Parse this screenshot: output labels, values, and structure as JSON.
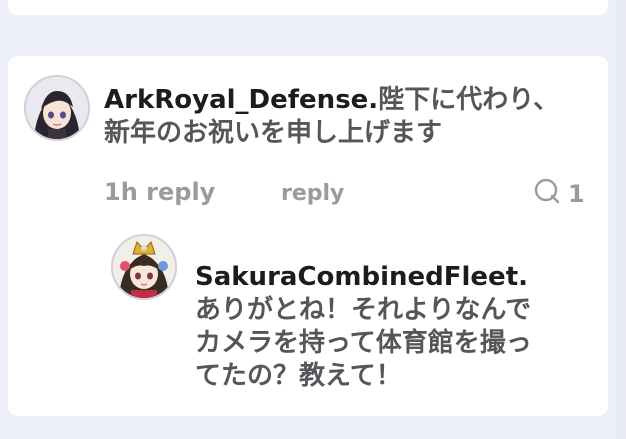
{
  "comment": {
    "username": "ArkRoyal_Defense.",
    "text": "陛下に代わり、新年のお祝いを申し上げます",
    "time": "1h",
    "time_reply_label": "reply",
    "reply_label": "reply",
    "reply_count": "1"
  },
  "reply": {
    "username": "SakuraCombinedFleet.",
    "text": "ありがとね！それよりなんでカメラを持って体育館を撮ってたの？教えて！"
  },
  "icons": {
    "comment": "speech-bubble-icon"
  },
  "colors": {
    "background": "#eef0f9",
    "card": "#ffffff",
    "text": "#555659",
    "username": "#1c1c1e",
    "meta": "#9a9ba0"
  }
}
